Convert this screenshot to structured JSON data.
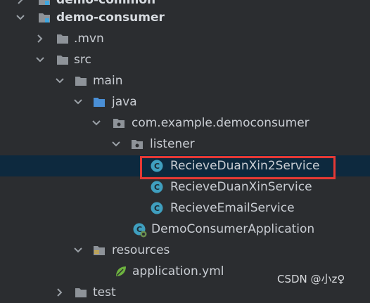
{
  "tree": {
    "items": [
      {
        "label": "demo-common",
        "icon": "module-folder-icon",
        "expanded": false
      },
      {
        "label": "demo-consumer",
        "icon": "module-folder-icon",
        "expanded": true
      },
      {
        "label": ".mvn",
        "icon": "folder-icon",
        "expanded": false
      },
      {
        "label": "src",
        "icon": "folder-icon",
        "expanded": true
      },
      {
        "label": "main",
        "icon": "folder-icon",
        "expanded": true
      },
      {
        "label": "java",
        "icon": "source-folder-icon",
        "expanded": true
      },
      {
        "label": "com.example.democonsumer",
        "icon": "package-icon",
        "expanded": true
      },
      {
        "label": "listener",
        "icon": "package-icon",
        "expanded": true
      },
      {
        "label": "RecieveDuanXin2Service",
        "icon": "class-icon",
        "selected": true
      },
      {
        "label": "RecieveDuanXinService",
        "icon": "class-icon"
      },
      {
        "label": "RecieveEmailService",
        "icon": "class-icon"
      },
      {
        "label": "DemoConsumerApplication",
        "icon": "spring-app-class-icon"
      },
      {
        "label": "resources",
        "icon": "resources-folder-icon",
        "expanded": true
      },
      {
        "label": "application.yml",
        "icon": "spring-yml-icon"
      },
      {
        "label": "test",
        "icon": "folder-icon",
        "expanded": false
      }
    ]
  },
  "watermark": "CSDN @小z♀",
  "colors": {
    "background": "#2b2d30",
    "selection": "#0d293e",
    "highlight_box": "#e53935",
    "class_icon": "#3f9fbf",
    "source_folder": "#4a8fd6"
  }
}
